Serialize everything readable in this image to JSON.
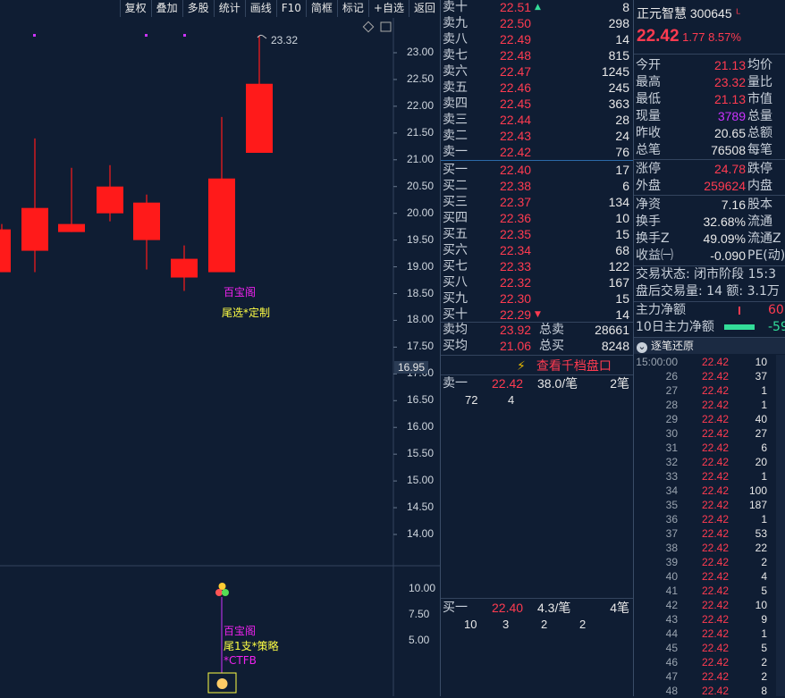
{
  "toolbar": {
    "items": [
      "复权",
      "叠加",
      "多股",
      "统计",
      "画线",
      "F10",
      "简框",
      "标记",
      "+自选",
      "返回"
    ]
  },
  "chart": {
    "price_labels": [
      "23.00",
      "22.50",
      "22.00",
      "21.50",
      "21.00",
      "20.50",
      "20.00",
      "19.50",
      "19.00",
      "18.50",
      "18.00",
      "17.50",
      "17.00",
      "16.50",
      "16.00",
      "15.50",
      "15.00",
      "14.50",
      "14.00"
    ],
    "current_price_tag": "16.95",
    "high_marker": "23.32",
    "annot1": "百宝阁",
    "annot2": "尾选*定制",
    "volume_labels": [
      "10.00",
      "7.50",
      "5.00"
    ],
    "annot3": "百宝阁",
    "annot4": "尾1支*策略",
    "annot5": "*CTFB",
    "colors": {
      "up": "#ff1a1a",
      "bg": "#0f1d33"
    }
  },
  "chart_data": {
    "type": "candlestick",
    "yticks": [
      23.0,
      22.5,
      22.0,
      21.5,
      21.0,
      20.5,
      20.0,
      19.5,
      19.0,
      18.5,
      18.0,
      17.5,
      17.0,
      16.5,
      16.0,
      15.5,
      15.0,
      14.5,
      14.0
    ],
    "candles": [
      {
        "open": 18.9,
        "close": 19.7,
        "high": 19.8,
        "low": 18.9
      },
      {
        "open": 19.3,
        "close": 20.1,
        "high": 21.4,
        "low": 18.9
      },
      {
        "open": 19.65,
        "close": 19.8,
        "high": 20.85,
        "low": 19.65
      },
      {
        "open": 20.0,
        "close": 20.5,
        "high": 20.9,
        "low": 19.85
      },
      {
        "open": 19.5,
        "close": 20.2,
        "high": 20.35,
        "low": 18.95
      },
      {
        "open": 18.8,
        "close": 19.15,
        "high": 19.4,
        "low": 18.55
      },
      {
        "open": 18.9,
        "close": 20.65,
        "high": 21.8,
        "low": 18.9
      },
      {
        "open": 21.13,
        "close": 22.42,
        "high": 23.32,
        "low": 21.13
      }
    ]
  },
  "book": {
    "asks": [
      {
        "label": "卖十",
        "price": "22.51",
        "vol": "8"
      },
      {
        "label": "卖九",
        "price": "22.50",
        "vol": "298"
      },
      {
        "label": "卖八",
        "price": "22.49",
        "vol": "14"
      },
      {
        "label": "卖七",
        "price": "22.48",
        "vol": "815"
      },
      {
        "label": "卖六",
        "price": "22.47",
        "vol": "1245"
      },
      {
        "label": "卖五",
        "price": "22.46",
        "vol": "245"
      },
      {
        "label": "卖四",
        "price": "22.45",
        "vol": "363"
      },
      {
        "label": "卖三",
        "price": "22.44",
        "vol": "28"
      },
      {
        "label": "卖二",
        "price": "22.43",
        "vol": "24"
      },
      {
        "label": "卖一",
        "price": "22.42",
        "vol": "76"
      }
    ],
    "bids": [
      {
        "label": "买一",
        "price": "22.40",
        "vol": "17"
      },
      {
        "label": "买二",
        "price": "22.38",
        "vol": "6"
      },
      {
        "label": "买三",
        "price": "22.37",
        "vol": "134"
      },
      {
        "label": "买四",
        "price": "22.36",
        "vol": "10"
      },
      {
        "label": "买五",
        "price": "22.35",
        "vol": "15"
      },
      {
        "label": "买六",
        "price": "22.34",
        "vol": "68"
      },
      {
        "label": "买七",
        "price": "22.33",
        "vol": "122"
      },
      {
        "label": "买八",
        "price": "22.32",
        "vol": "167"
      },
      {
        "label": "买九",
        "price": "22.30",
        "vol": "15"
      },
      {
        "label": "买十",
        "price": "22.29",
        "vol": "14"
      }
    ],
    "avg_sell_label": "卖均",
    "avg_sell": "23.92",
    "total_sell_label": "总卖",
    "total_sell": "28661",
    "avg_buy_label": "买均",
    "avg_buy": "21.06",
    "total_buy_label": "总买",
    "total_buy": "8248",
    "view_1000": "查看千档盘口",
    "ask1_detail": {
      "label": "卖一",
      "price": "22.42",
      "per": "38.0/笔",
      "count": "2笔",
      "queue": [
        "72",
        "4"
      ]
    },
    "bid1_detail": {
      "label": "买一",
      "price": "22.40",
      "per": "4.3/笔",
      "count": "4笔",
      "queue": [
        "10",
        "3",
        "2",
        "2"
      ]
    }
  },
  "info": {
    "name": "正元智慧",
    "code": "300645",
    "price": "22.42",
    "change": "1.77",
    "pct": "8.57%",
    "rows": [
      {
        "l": "今开",
        "v": "21.13",
        "c": "red",
        "r": "均价"
      },
      {
        "l": "最高",
        "v": "23.32",
        "c": "red",
        "r": "量比"
      },
      {
        "l": "最低",
        "v": "21.13",
        "c": "red",
        "r": "市值"
      },
      {
        "l": "现量",
        "v": "3789",
        "c": "purple",
        "r": "总量"
      },
      {
        "l": "昨收",
        "v": "20.65",
        "c": "white",
        "r": "总额"
      },
      {
        "l": "总笔",
        "v": "76508",
        "c": "white",
        "r": "每笔"
      },
      {
        "l": "涨停",
        "v": "24.78",
        "c": "red",
        "r": "跌停"
      },
      {
        "l": "外盘",
        "v": "259624",
        "c": "red",
        "r": "内盘"
      },
      {
        "l": "净资",
        "v": "7.16",
        "c": "white",
        "r": "股本"
      },
      {
        "l": "换手",
        "v": "32.68%",
        "c": "white",
        "r": "流通"
      },
      {
        "l": "换手Z",
        "v": "49.09%",
        "c": "white",
        "r": "流通Z"
      },
      {
        "l": "收益㈠",
        "v": "-0.090",
        "c": "white",
        "r": "PE(动)"
      }
    ],
    "trade_status": "交易状态: 闭市阶段 15:3",
    "after_hours": "盘后交易量: 14  额: 3.1万",
    "main_net": "主力净额",
    "main_net_val": "60",
    "main_net10": "10日主力净额",
    "main_net10_val": "-59",
    "tick_header": "逐笔还原"
  },
  "trades": [
    {
      "t": "15:00:00",
      "p": "22.42",
      "v": "10"
    },
    {
      "t": "26",
      "p": "22.42",
      "v": "37"
    },
    {
      "t": "27",
      "p": "22.42",
      "v": "1"
    },
    {
      "t": "28",
      "p": "22.42",
      "v": "1"
    },
    {
      "t": "29",
      "p": "22.42",
      "v": "40"
    },
    {
      "t": "30",
      "p": "22.42",
      "v": "27"
    },
    {
      "t": "31",
      "p": "22.42",
      "v": "6"
    },
    {
      "t": "32",
      "p": "22.42",
      "v": "20"
    },
    {
      "t": "33",
      "p": "22.42",
      "v": "1"
    },
    {
      "t": "34",
      "p": "22.42",
      "v": "100"
    },
    {
      "t": "35",
      "p": "22.42",
      "v": "187"
    },
    {
      "t": "36",
      "p": "22.42",
      "v": "1"
    },
    {
      "t": "37",
      "p": "22.42",
      "v": "53"
    },
    {
      "t": "38",
      "p": "22.42",
      "v": "22"
    },
    {
      "t": "39",
      "p": "22.42",
      "v": "2"
    },
    {
      "t": "40",
      "p": "22.42",
      "v": "4"
    },
    {
      "t": "41",
      "p": "22.42",
      "v": "5"
    },
    {
      "t": "42",
      "p": "22.42",
      "v": "10"
    },
    {
      "t": "43",
      "p": "22.42",
      "v": "9"
    },
    {
      "t": "44",
      "p": "22.42",
      "v": "1"
    },
    {
      "t": "45",
      "p": "22.42",
      "v": "5"
    },
    {
      "t": "46",
      "p": "22.42",
      "v": "2"
    },
    {
      "t": "47",
      "p": "22.42",
      "v": "2"
    },
    {
      "t": "48",
      "p": "22.42",
      "v": "8"
    }
  ]
}
